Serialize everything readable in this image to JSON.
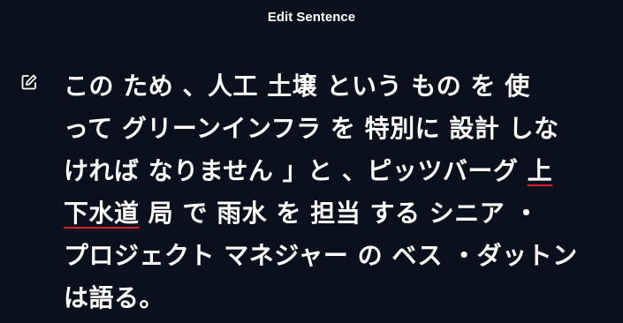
{
  "header": {
    "title": "Edit Sentence"
  },
  "colors": {
    "background": "#0b111c",
    "text": "#ffffff",
    "underline": "#d8202b"
  },
  "sentence": {
    "edit_icon": "pencil-edit-icon",
    "lines": [
      {
        "before": "この ため 、人工 土壌 という もの を 使",
        "flagged": "",
        "after": ""
      },
      {
        "before": "って グリーンインフラ を 特別に 設計 しな",
        "flagged": "",
        "after": ""
      },
      {
        "before": "ければ なりません 」と 、ピッツバーグ ",
        "flagged": "上",
        "after": ""
      },
      {
        "before": "",
        "flagged": "下水道",
        "after": " 局 で 雨水 を 担当 する シニア ・"
      },
      {
        "before": "プロジェクト マネジャー の ベス ・ダットン",
        "flagged": "",
        "after": ""
      },
      {
        "before": "は語る。",
        "flagged": "",
        "after": ""
      }
    ]
  }
}
